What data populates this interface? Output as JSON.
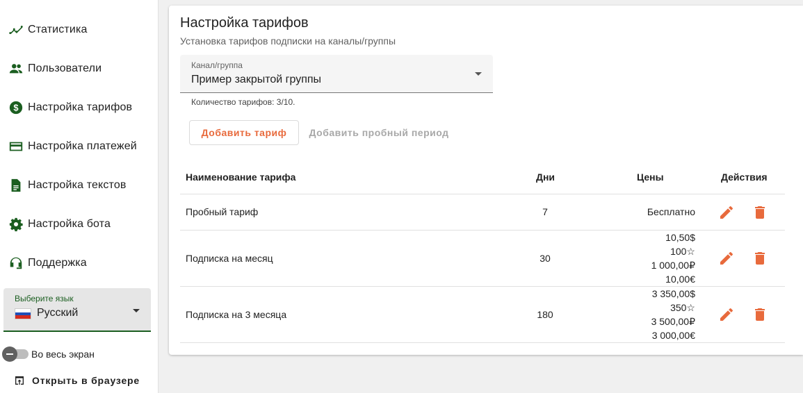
{
  "sidebar": {
    "items": [
      {
        "label": "Статистика",
        "icon": "chart-line-icon"
      },
      {
        "label": "Пользователи",
        "icon": "users-icon"
      },
      {
        "label": "Настройка тарифов",
        "icon": "dollar-circle-icon"
      },
      {
        "label": "Настройка платежей",
        "icon": "credit-card-icon"
      },
      {
        "label": "Настройка текстов",
        "icon": "document-icon"
      },
      {
        "label": "Настройка бота",
        "icon": "gear-icon"
      },
      {
        "label": "Поддержка",
        "icon": "headset-icon"
      }
    ],
    "language": {
      "label": "Выберите язык",
      "value": "Русский",
      "flag": "russia-flag-icon"
    },
    "fullscreen": {
      "label": "Во весь экран",
      "checked": false
    },
    "open_browser": {
      "label": "Открыть в браузере",
      "icon": "open-in-browser-icon"
    }
  },
  "main": {
    "title": "Настройка тарифов",
    "subtitle": "Установка тарифов подписки на каналы/группы",
    "channel_select": {
      "label": "Канал/группа",
      "value": "Пример закрытой группы"
    },
    "tariff_count": "Количество тарифов: 3/10.",
    "add_button": "Добавить тариф",
    "trial_button": "Добавить пробный период",
    "table": {
      "headers": {
        "name": "Наименование тарифа",
        "days": "Дни",
        "prices": "Цены",
        "actions": "Действия"
      },
      "rows": [
        {
          "name": "Пробный тариф",
          "days": "7",
          "prices": [
            "Бесплатно"
          ]
        },
        {
          "name": "Подписка на месяц",
          "days": "30",
          "prices": [
            "10,50$",
            "100☆",
            "1 000,00₽",
            "10,00€"
          ]
        },
        {
          "name": "Подписка на 3 месяца",
          "days": "180",
          "prices": [
            "3 350,00$",
            "350☆",
            "3 500,00₽",
            "3 000,00€"
          ]
        }
      ]
    }
  },
  "colors": {
    "accent": "#e86a3c",
    "primary": "#1b5e20",
    "disabled": "#a8a8a8"
  }
}
